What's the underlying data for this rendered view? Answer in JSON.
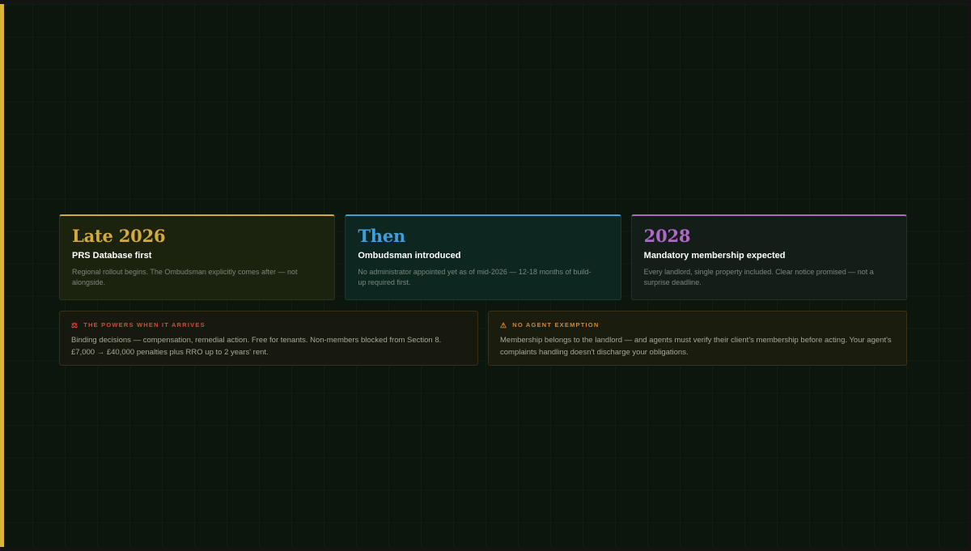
{
  "colors": {
    "background": "#0b170d",
    "accent_bar": "#d9b53b",
    "gold": "#d4aa3d",
    "blue": "#3d9fdb",
    "purple": "#b067c8",
    "red_label": "#d9483a",
    "orange_label": "#d9852d"
  },
  "cards": [
    {
      "heading": "Late 2026",
      "title": "PRS Database first",
      "description": "Regional rollout begins. The Ombudsman explicitly comes after — not alongside.",
      "accent": "#d4aa3d",
      "background": "#1b230e"
    },
    {
      "heading": "Then",
      "title": "Ombudsman introduced",
      "description": "No administrator appointed yet as of mid-2026 — 12-18 months of build-up required first.",
      "accent": "#3d9fdb",
      "background": "#0d2620"
    },
    {
      "heading": "2028",
      "title": "Mandatory membership expected",
      "description": "Every landlord, single property included. Clear notice promised — not a surprise deadline.",
      "accent": "#b067c8",
      "background": "#141e18"
    }
  ],
  "notes": [
    {
      "icon": "gavel-icon",
      "icon_glyph": "⚖",
      "label": "THE POWERS WHEN IT ARRIVES",
      "text": "Binding decisions — compensation, remedial action. Free for tenants. Non-members blocked from Section 8. £7,000 → £40,000 penalties plus RRO up to 2 years' rent.",
      "label_color": "#d9483a",
      "border": "#3a2e14",
      "background": "#18190e"
    },
    {
      "icon": "warning-icon",
      "icon_glyph": "⚠",
      "label": "NO AGENT EXEMPTION",
      "text": "Membership belongs to the landlord — and agents must verify their client's membership before acting. Your agent's complaints handling doesn't discharge your obligations.",
      "label_color": "#d9852d",
      "border": "#3a3214",
      "background": "#1a1d0e"
    }
  ]
}
